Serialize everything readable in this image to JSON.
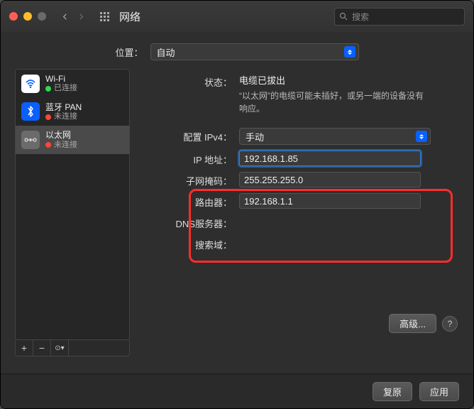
{
  "titlebar": {
    "title": "网络",
    "search_placeholder": "搜索"
  },
  "location": {
    "label": "位置：",
    "value": "自动"
  },
  "sidebar": {
    "items": [
      {
        "name": "Wi-Fi",
        "status": "已连接",
        "color": "green"
      },
      {
        "name": "蓝牙 PAN",
        "status": "未连接",
        "color": "red"
      },
      {
        "name": "以太网",
        "status": "未连接",
        "color": "red"
      }
    ]
  },
  "detail": {
    "status_label": "状态：",
    "status_value": "电缆已拔出",
    "status_msg": "“以太网”的电缆可能未插好，或另一端的设备没有响应。",
    "config_label": "配置 IPv4：",
    "config_value": "手动",
    "ip_label": "IP 地址：",
    "ip_value": "192.168.1.85",
    "mask_label": "子网掩码：",
    "mask_value": "255.255.255.0",
    "router_label": "路由器：",
    "router_value": "192.168.1.1",
    "dns_label": "DNS服务器：",
    "search_label": "搜索域："
  },
  "buttons": {
    "advanced": "高级...",
    "revert": "复原",
    "apply": "应用"
  }
}
